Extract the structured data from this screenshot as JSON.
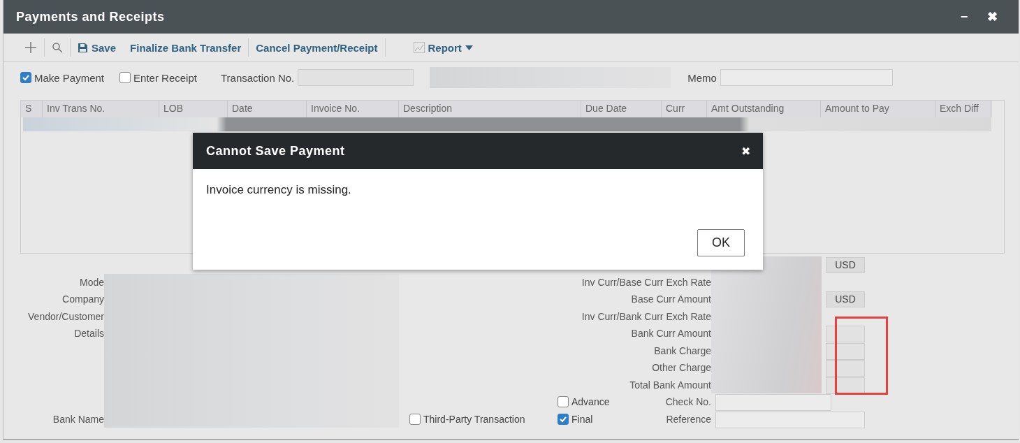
{
  "window": {
    "title": "Payments and Receipts",
    "controls": [
      "−",
      "✖"
    ]
  },
  "toolbar": [
    {
      "kind": "add"
    },
    {
      "kind": "search"
    },
    {
      "kind": "save",
      "label": "Save"
    },
    {
      "kind": "text",
      "label": "Finalize Bank Transfer"
    },
    {
      "kind": "text",
      "label": "Cancel Payment/Receipt"
    },
    {
      "kind": "report",
      "label": "Report"
    }
  ],
  "options": [
    {
      "label": "Make Payment",
      "checked": true
    },
    {
      "label": "Enter Receipt",
      "checked": false
    }
  ],
  "transaction_no": {
    "label": "Transaction No."
  },
  "memo": {
    "label": "Memo"
  },
  "table": {
    "columns": [
      "S",
      "Inv Trans No.",
      "LOB",
      "Date",
      "Invoice No.",
      "Description",
      "Due Date",
      "Curr",
      "Amt Outstanding",
      "Amount to Pay",
      "Exch Diff"
    ]
  },
  "party_fields": [
    "Mode",
    "Company",
    "Vendor/Customer",
    "Details"
  ],
  "bank_name": "Bank Name",
  "remaining_unit": "USD",
  "amounts": [
    {
      "kind": "rate",
      "label": "Inv Curr/Base Curr Exch Rate"
    },
    {
      "kind": "amount",
      "label": "Base Curr Amount",
      "unit": "USD"
    },
    {
      "kind": "rate",
      "label": "Inv Curr/Bank Curr Exch Rate"
    },
    {
      "kind": "bank",
      "label": "Bank Curr Amount"
    },
    {
      "kind": "bank",
      "label": "Bank Charge"
    },
    {
      "kind": "bank",
      "label": "Other Charge"
    },
    {
      "kind": "bank",
      "label": "Total Bank Amount"
    }
  ],
  "check_no": {
    "label": "Check No."
  },
  "reference": {
    "label": "Reference"
  },
  "flags": [
    {
      "label": "Advance",
      "checked": false
    },
    {
      "label": "Final",
      "checked": true
    },
    {
      "label": "Third-Party Transaction",
      "checked": false
    }
  ],
  "dialog": {
    "title": "Cannot Save Payment",
    "close": "✖",
    "message": "Invoice currency is missing.",
    "button": "OK"
  }
}
